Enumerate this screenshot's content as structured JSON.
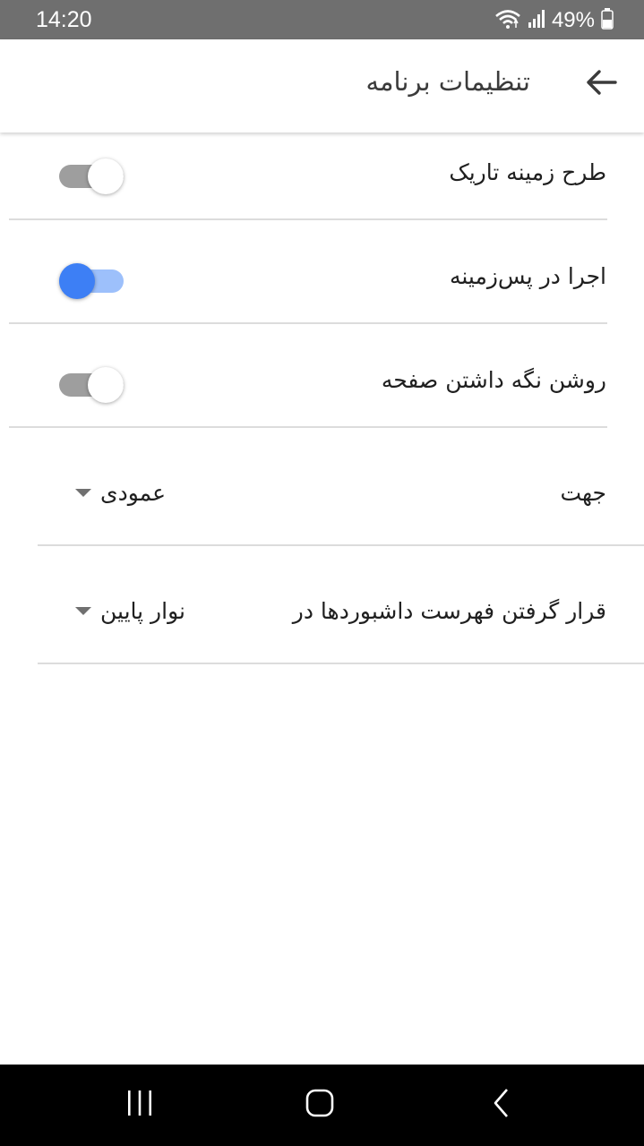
{
  "status_bar": {
    "time": "14:20",
    "battery_percent": "49%",
    "icons": [
      "wifi-icon",
      "signal-icon",
      "battery-icon"
    ]
  },
  "app_bar": {
    "title": "تنظیمات برنامه",
    "back_icon": "arrow-back-icon"
  },
  "settings": {
    "dark_theme": {
      "label": "طرح زمینه تاریک",
      "enabled": false
    },
    "run_in_background": {
      "label": "اجرا در پس‌زمینه",
      "enabled": true
    },
    "keep_screen_on": {
      "label": "روشن نگه داشتن صفحه",
      "enabled": false
    },
    "orientation": {
      "label": "جهت",
      "value": "عمودی"
    },
    "dashboard_list_position": {
      "label": "قرار گرفتن فهرست داشبوردها در",
      "value": "نوار پایین"
    }
  },
  "nav_bar": {
    "icons": [
      "recent-apps-icon",
      "home-icon",
      "back-icon"
    ]
  },
  "colors": {
    "status_bar": "#6f6f6f",
    "accent": "#3d7ff5",
    "accent_track": "#9dc0fb",
    "switch_off_track": "#9e9e9e",
    "switch_off_thumb": "#ffffff",
    "divider": "#dcdcdc",
    "nav_bar": "#000000"
  }
}
